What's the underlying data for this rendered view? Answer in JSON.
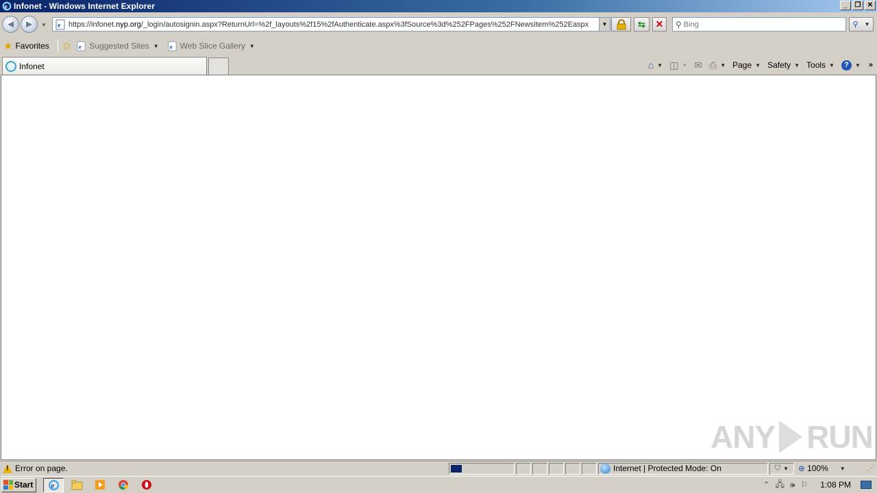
{
  "window": {
    "title": "Infonet - Windows Internet Explorer",
    "controls": {
      "minimize": "_",
      "restore": "❐",
      "close": "✕"
    }
  },
  "address_bar": {
    "url_prefix": "https://infonet.",
    "url_domain": "nyp.org",
    "url_rest": "/_login/autosignin.aspx?ReturnUrl=%2f_layouts%2f15%2fAuthenticate.aspx%3fSource%3d%252FPages%252FNewsItem%252Easpx"
  },
  "search": {
    "placeholder": "Bing"
  },
  "favorites_bar": {
    "favorites_label": "Favorites",
    "links": [
      {
        "label": "Suggested Sites"
      },
      {
        "label": "Web Slice Gallery"
      }
    ]
  },
  "tabs": [
    {
      "label": "Infonet"
    }
  ],
  "command_bar": {
    "page": "Page",
    "safety": "Safety",
    "tools": "Tools",
    "help": "?"
  },
  "status_bar": {
    "message": "Error on page.",
    "zone": "Internet | Protected Mode: On",
    "zoom": "100%"
  },
  "watermark": {
    "left": "ANY",
    "right": "RUN"
  },
  "taskbar": {
    "start_label": "Start",
    "clock": "1:08 PM"
  },
  "colors": {
    "title_bar": "#0a246a",
    "window_chrome": "#d4d0c8",
    "content_bg": "#ffffff"
  }
}
